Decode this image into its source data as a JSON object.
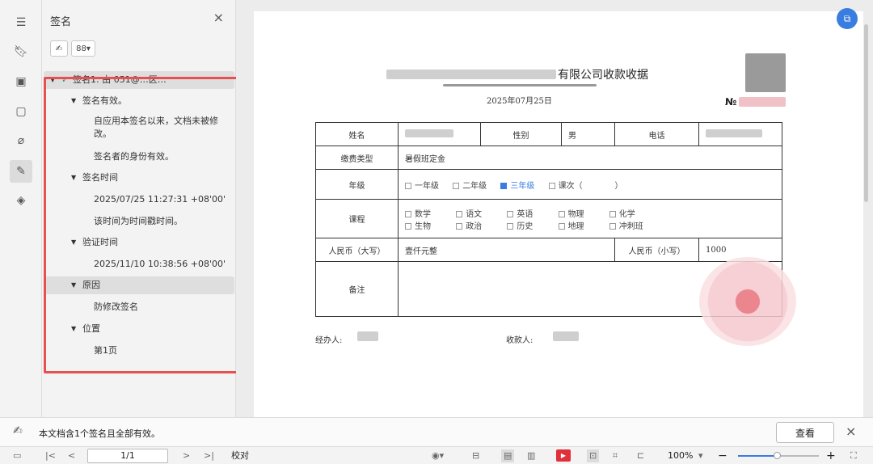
{
  "panel": {
    "title": "签名",
    "close": "×"
  },
  "toolbar": {
    "sign_icon": "pen-icon",
    "view_label": "88▾"
  },
  "tree": [
    {
      "level": 0,
      "label": "签名1: 由 051@…区…",
      "icon": "signature-valid-icon"
    },
    {
      "level": 1,
      "label": "签名有效。"
    },
    {
      "level": 2,
      "label": "自应用本签名以来，文档未被修"
    },
    {
      "level": 2,
      "label": "改。"
    },
    {
      "level": 2,
      "label": "签名者的身份有效。"
    },
    {
      "level": 1,
      "label": "签名时间"
    },
    {
      "level": 2,
      "label": "2025/07/25 11:27:31 +08'00'"
    },
    {
      "level": 2,
      "label": "该时间为时间戳时间。"
    },
    {
      "level": 1,
      "label": "验证时间"
    },
    {
      "level": 2,
      "label": "2025/11/10 10:38:56 +08'00'"
    },
    {
      "level": 1,
      "label": "原因"
    },
    {
      "level": 2,
      "label": "防修改签名"
    },
    {
      "level": 1,
      "label": "位置"
    },
    {
      "level": 2,
      "label": "第1页"
    }
  ],
  "doc": {
    "title": "有限公司收款收据",
    "date": "2025年07月25日",
    "no_label": "№",
    "name_label": "姓名",
    "gender_label": "性别",
    "gender_value": "男",
    "phone_label": "电话",
    "fee_label": "缴费类型",
    "fee_value": "暑假班定金",
    "grade_label": "年级",
    "grades": [
      "一年级",
      "二年级",
      "三年级",
      "课次（　　　　）"
    ],
    "course_label": "课程",
    "courses_row1": [
      "数学",
      "语文",
      "英语",
      "物理",
      "化学"
    ],
    "courses_row2": [
      "生物",
      "政治",
      "历史",
      "地理",
      "冲刺班"
    ],
    "rmb_big_label": "人民币（大写）",
    "rmb_big_value": "壹仟元整",
    "rmb_small_label": "人民币（小写）",
    "rmb_small_value": "1000",
    "remark_label": "备注",
    "handler_label": "经办人:",
    "payee_label": "收款人:"
  },
  "status": {
    "message": "本文档含1个签名且全部有效。",
    "view_button": "查看"
  },
  "bottombar": {
    "page": "1/1",
    "proof": "校对",
    "zoom": "100%"
  }
}
